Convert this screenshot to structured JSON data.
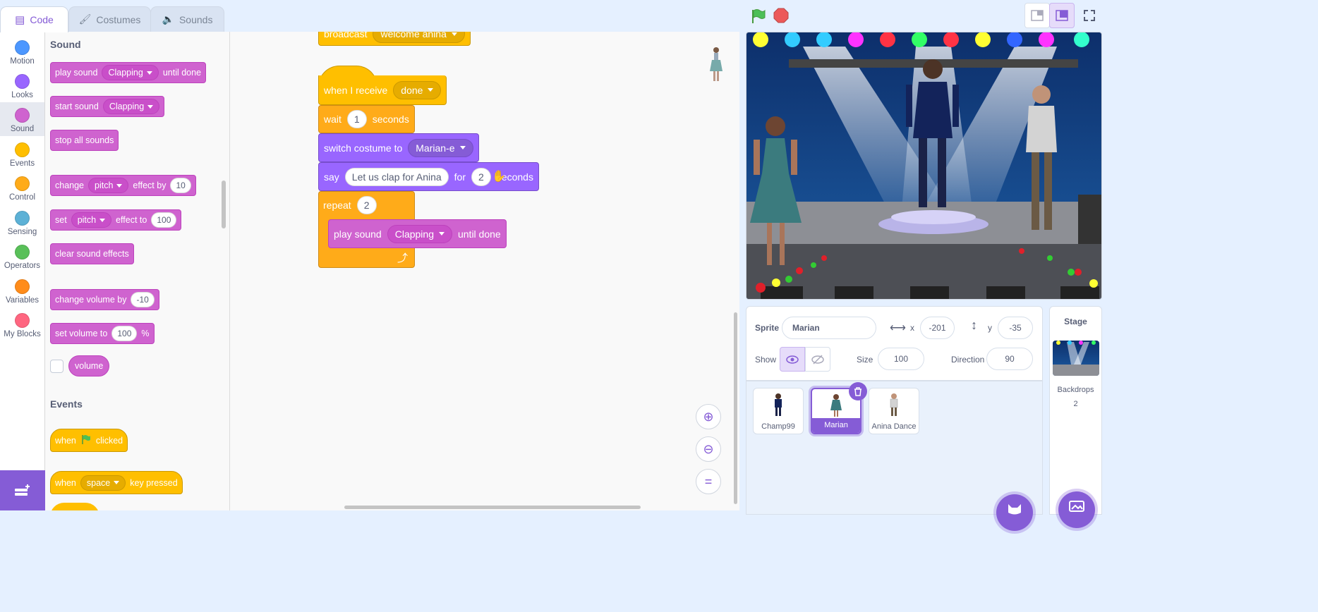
{
  "tabs": [
    {
      "label": "Code"
    },
    {
      "label": "Costumes"
    },
    {
      "label": "Sounds"
    }
  ],
  "categories": [
    {
      "label": "Motion",
      "color": "#4c97ff"
    },
    {
      "label": "Looks",
      "color": "#9966ff"
    },
    {
      "label": "Sound",
      "color": "#cf63cf"
    },
    {
      "label": "Events",
      "color": "#ffbf00"
    },
    {
      "label": "Control",
      "color": "#ffab19"
    },
    {
      "label": "Sensing",
      "color": "#5cb1d6"
    },
    {
      "label": "Operators",
      "color": "#59c059"
    },
    {
      "label": "Variables",
      "color": "#ff8c1a"
    },
    {
      "label": "My Blocks",
      "color": "#ff6680"
    }
  ],
  "palette": {
    "sound_heading": "Sound",
    "events_heading": "Events",
    "b1": {
      "a": "play sound",
      "dd": "Clapping",
      "b": "until done"
    },
    "b2": {
      "a": "start sound",
      "dd": "Clapping"
    },
    "b3": {
      "a": "stop all sounds"
    },
    "b4": {
      "a": "change",
      "dd": "pitch",
      "b": "effect by",
      "v": "10"
    },
    "b5": {
      "a": "set",
      "dd": "pitch",
      "b": "effect to",
      "v": "100"
    },
    "b6": {
      "a": "clear sound effects"
    },
    "b7": {
      "a": "change volume by",
      "v": "-10"
    },
    "b8": {
      "a": "set volume to",
      "v": "100",
      "b": "%"
    },
    "b9": {
      "a": "volume"
    },
    "e1": {
      "a": "when",
      "b": "clicked"
    },
    "e2": {
      "a": "when",
      "dd": "space",
      "b": "key pressed"
    }
  },
  "script": {
    "broadcast": {
      "a": "broadcast",
      "dd": "welcome anina"
    },
    "hat": {
      "a": "when I receive",
      "dd": "done"
    },
    "wait": {
      "a": "wait",
      "v": "1",
      "b": "seconds"
    },
    "costume": {
      "a": "switch costume to",
      "dd": "Marian-e"
    },
    "say": {
      "a": "say",
      "v": "Let us clap for Anina",
      "b": "for",
      "v2": "2",
      "c": "seconds"
    },
    "repeat": {
      "a": "repeat",
      "v": "2"
    },
    "play": {
      "a": "play sound",
      "dd": "Clapping",
      "b": "until done"
    }
  },
  "sprite_info": {
    "sprite_label": "Sprite",
    "sprite_name": "Marian",
    "x_label": "x",
    "x": "-201",
    "y_label": "y",
    "y": "-35",
    "show_label": "Show",
    "size_label": "Size",
    "size": "100",
    "direction_label": "Direction",
    "direction": "90"
  },
  "sprites": [
    {
      "name": "Champ99"
    },
    {
      "name": "Marian",
      "selected": true
    },
    {
      "name": "Anina Dance"
    }
  ],
  "stage_panel": {
    "title": "Stage",
    "backdrops_label": "Backdrops",
    "backdrops_count": "2"
  },
  "icons": {
    "flag": "green-flag-icon",
    "stop": "stop-icon",
    "fullscreen": "fullscreen-icon"
  }
}
